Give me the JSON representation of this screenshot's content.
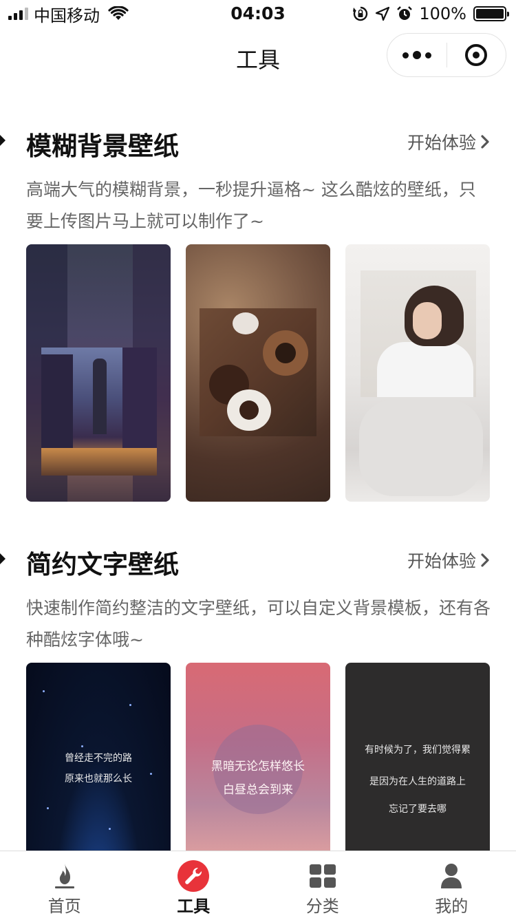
{
  "status_bar": {
    "carrier": "中国移动",
    "time": "04:03",
    "battery": "100%",
    "battery_level": 1.0,
    "signal_bars": 3
  },
  "nav": {
    "title": "工具"
  },
  "sections": [
    {
      "title": "模糊背景壁纸",
      "link": "开始体验",
      "description": "高端大气的模糊背景，一秒提升逼格~ 这么酷炫的壁纸，只要上传图片马上就可以制作了~"
    },
    {
      "title": "简约文字壁纸",
      "link": "开始体验",
      "description": "快速制作简约整洁的文字壁纸，可以自定义背景模板，还有各种酷炫字体哦~",
      "cards": [
        {
          "lines": [
            "曾经走不完的路",
            "原来也就那么长"
          ]
        },
        {
          "lines": [
            "黑暗无论怎样悠长",
            "白昼总会到来"
          ]
        },
        {
          "lines": [
            "有时候为了，我们觉得累",
            "是因为在人生的道路上",
            "忘记了要去哪"
          ]
        }
      ]
    }
  ],
  "tab_bar": {
    "items": [
      {
        "label": "首页",
        "icon": "flame-icon",
        "active": false
      },
      {
        "label": "工具",
        "icon": "wrench-icon",
        "active": true
      },
      {
        "label": "分类",
        "icon": "grid-icon",
        "active": false
      },
      {
        "label": "我的",
        "icon": "user-icon",
        "active": false
      }
    ]
  },
  "colors": {
    "accent": "#e8333a",
    "text_primary": "#111111",
    "text_secondary": "#666666",
    "tab_icon_gray": "#555555"
  }
}
